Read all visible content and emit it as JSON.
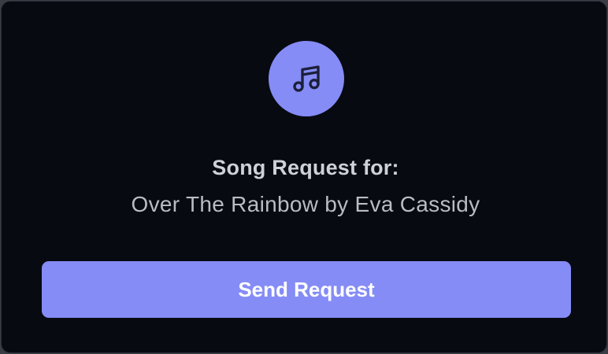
{
  "card": {
    "icon": "music-note-icon",
    "title": "Song Request for:",
    "song": "Over The Rainbow by Eva Cassidy",
    "button_label": "Send Request"
  },
  "colors": {
    "background": "#080a12",
    "accent": "#858cf6",
    "title_text": "#cfd1d8",
    "subtitle_text": "#b9bcc5",
    "button_text": "#ffffff"
  }
}
